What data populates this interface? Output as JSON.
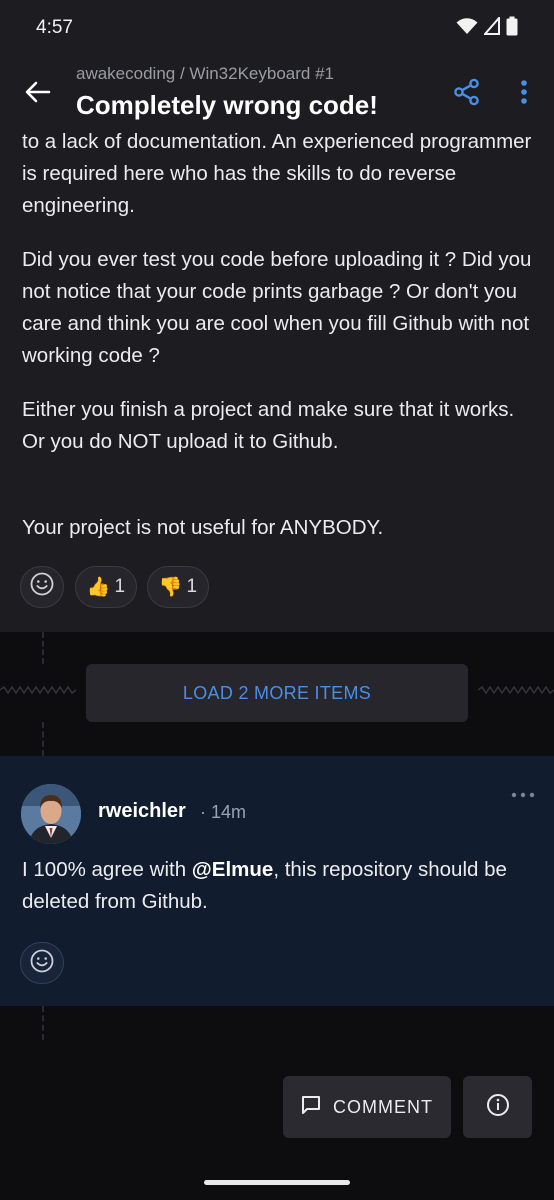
{
  "status_bar": {
    "time": "4:57",
    "icons": [
      "wifi-icon",
      "signal-icon",
      "battery-icon"
    ]
  },
  "header": {
    "repo": "awakecoding / Win32Keyboard #1",
    "title": "Completely wrong code!",
    "icons": [
      "back-arrow-icon",
      "share-icon",
      "more-vert-icon"
    ]
  },
  "comment1": {
    "paragraphs": [
      "to a lack of documentation. An experienced programmer is required here who has the skills to do reverse engineering.",
      "Did you ever test you code before uploading it ? Did you not notice that your code prints garbage ? Or don't you care and think you are cool when you fill Github with not working code ?",
      "Either you finish a project and make sure that it works.",
      "Or you do NOT upload it to Github.",
      "Your project is not useful for ANYBODY."
    ],
    "reactions": {
      "thumbs_up_emoji": "👍",
      "thumbs_up_count": "1",
      "thumbs_down_emoji": "👎",
      "thumbs_down_count": "1"
    }
  },
  "load_more": {
    "label": "LOAD 2 MORE ITEMS"
  },
  "comment2": {
    "author": "rweichler",
    "time": "· 14m",
    "text_before": "I 100% agree with ",
    "mention": "@Elmue",
    "text_after": ", this repository should be deleted from Github."
  },
  "actions": {
    "comment_label": "COMMENT"
  },
  "colors": {
    "accent": "#4a8fe7",
    "surface": "#1c1c21",
    "background": "#0d0d10",
    "highlight_card": "#111c2e"
  }
}
